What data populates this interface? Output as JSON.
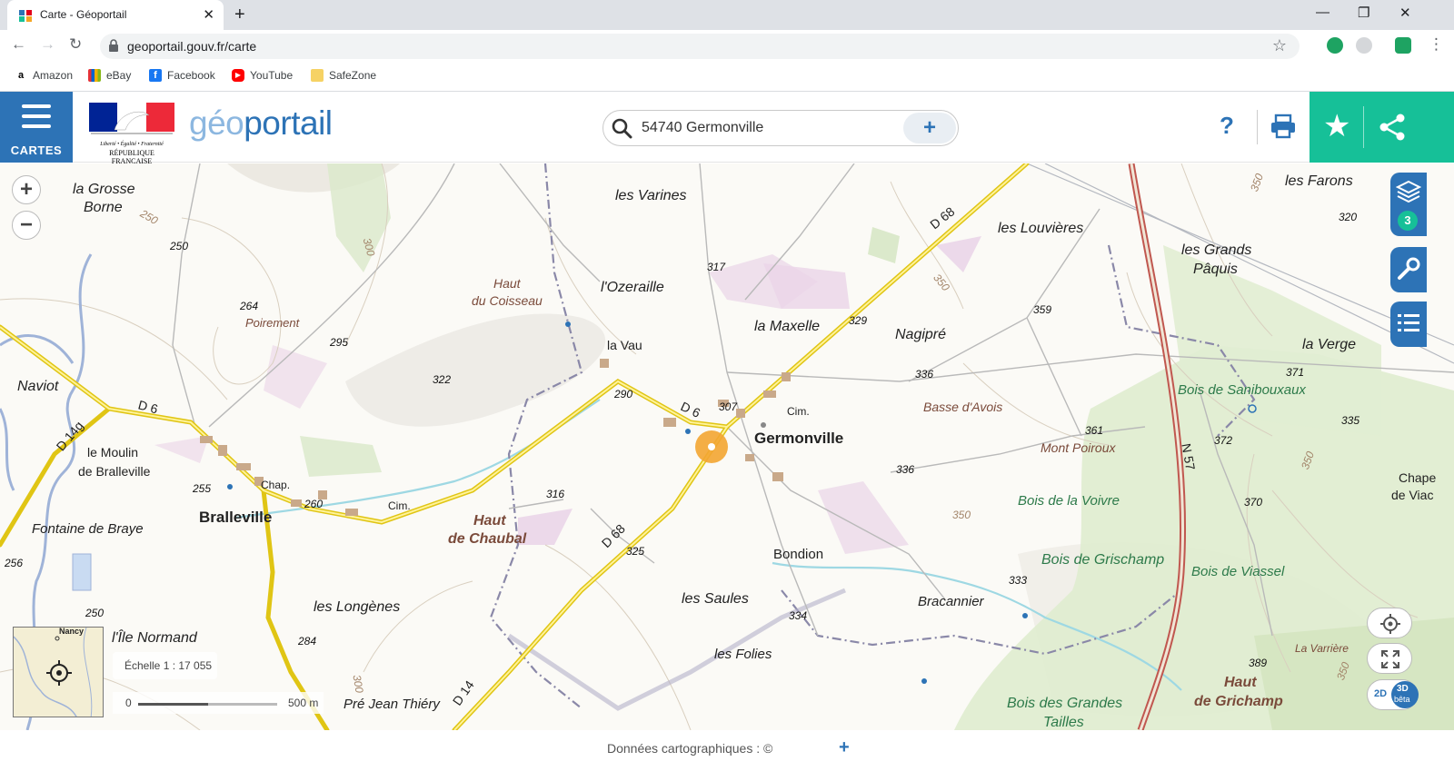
{
  "browser": {
    "tab_title": "Carte - Géoportail",
    "tab_close": "✕",
    "new_tab": "+",
    "url": "geoportail.gouv.fr/carte",
    "window_controls": [
      "—",
      "❐",
      "✕"
    ],
    "bookmarks": [
      {
        "label": "Amazon",
        "icon": "amazon-icon",
        "color": "#000000"
      },
      {
        "label": "eBay",
        "icon": "ebay-icon",
        "color": "#e53238"
      },
      {
        "label": "Facebook",
        "icon": "facebook-icon",
        "color": "#1877f2"
      },
      {
        "label": "YouTube",
        "icon": "youtube-icon",
        "color": "#ff0000"
      },
      {
        "label": "SafeZone",
        "icon": "folder-icon",
        "color": "#f6d264"
      }
    ]
  },
  "header": {
    "menu_label": "CARTES",
    "rf_line1": "Liberté • Égalité • Fraternité",
    "rf_line2": "RÉPUBLIQUE FRANÇAISE",
    "logo_geo": "géo",
    "logo_portail": "portail",
    "search_value": "54740 Germonville",
    "search_add": "+",
    "help": "?",
    "colors": {
      "blue": "#2d73b6",
      "green": "#16c098"
    }
  },
  "map": {
    "zoom_in": "+",
    "zoom_out": "−",
    "layers_count": "3",
    "scale_label": "Échelle 1 : 17 055",
    "scale_min": "0",
    "scale_max": "500 m",
    "minimap_label": "Nancy",
    "btn_2d": "2D",
    "btn_3d": "3D",
    "btn_beta": "bêta",
    "place_names": [
      "la Grosse",
      "Borne",
      "les Varines",
      "les Louvières",
      "les Farons",
      "les Grands",
      "Pâquis",
      "Haut",
      "du Coisseau",
      "l'Ozeraille",
      "Poirement",
      "la Vau",
      "la Maxelle",
      "Nagipré",
      "Naviot",
      "la Verge",
      "Bois de Sanibouxaux",
      "Basse d'Avois",
      "Cim.",
      "Germonville",
      "le Moulin",
      "de Bralleville",
      "Chap.",
      "Bralleville",
      "Cim.",
      "Haut",
      "de Chaubal",
      "Mont Poiroux",
      "Bois de la Voivre",
      "Fontaine de Braye",
      "Bois de Grischamp",
      "Bois de Viassel",
      "Chape",
      "de Viac",
      "Bondion",
      "les Longènes",
      "les Saules",
      "Bracannier",
      "l'Île Normand",
      "les Folies",
      "La Varrière",
      "Haut",
      "de Grichamp",
      "Pré Jean Thiéry",
      "Bois des Grandes",
      "Tailles"
    ],
    "road_labels": [
      "D 68",
      "D 6",
      "D 14g",
      "D 6",
      "D 68",
      "N 57",
      "D 14"
    ],
    "altitudes": [
      "250",
      "250",
      "264",
      "295",
      "322",
      "317",
      "300",
      "290",
      "307",
      "329",
      "336",
      "359",
      "361",
      "336",
      "371",
      "335",
      "320",
      "372",
      "370",
      "255",
      "260",
      "316",
      "325",
      "256",
      "250",
      "333",
      "334",
      "284",
      "389",
      "350",
      "350",
      "350",
      "350",
      "300",
      "350"
    ]
  },
  "footer": {
    "credit": "Données cartographiques : ©",
    "plus": "+"
  }
}
